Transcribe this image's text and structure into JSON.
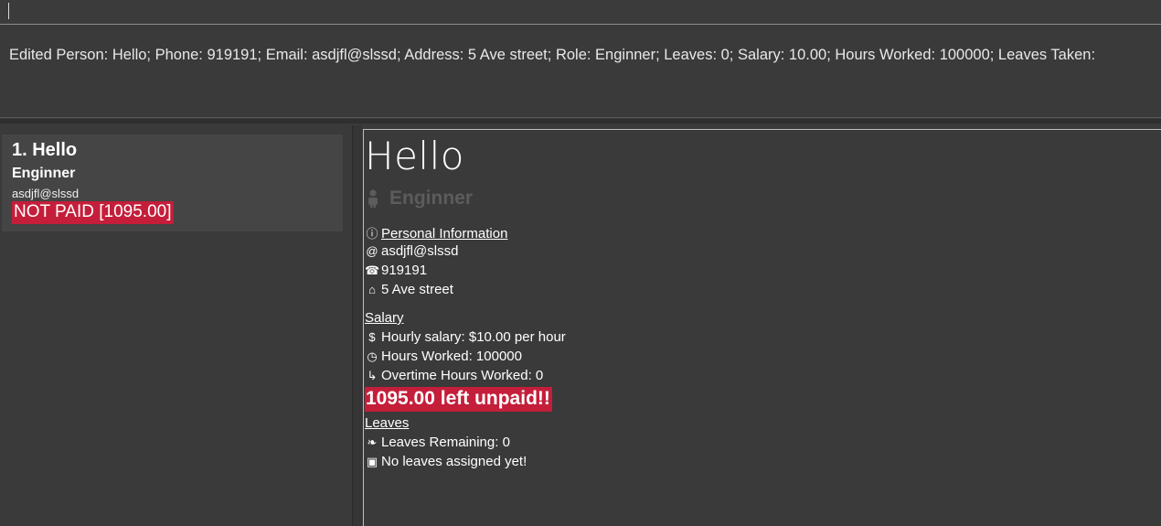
{
  "command": {
    "value": "",
    "placeholder": ""
  },
  "result": {
    "message": "Edited Person: Hello; Phone: 919191; Email: asdjfl@slssd; Address: 5 Ave street; Role: Enginner; Leaves: 0; Salary: 10.00; Hours Worked: 100000; Leaves Taken:"
  },
  "list": {
    "cards": [
      {
        "index_name": "1.  Hello",
        "role": "Enginner",
        "email": "asdjfl@slssd",
        "badge": "NOT PAID [1095.00]"
      }
    ]
  },
  "detail": {
    "name": "Hello",
    "role": "Enginner",
    "personal_title": "Personal Information",
    "email": "asdjfl@slssd",
    "phone": "919191",
    "address": "5 Ave street",
    "salary_title": "Salary",
    "hourly_salary": "Hourly salary: $10.00 per hour",
    "hours_worked": "Hours Worked: 100000",
    "overtime": "Overtime Hours Worked: 0",
    "unpaid": "1095.00 left unpaid!!",
    "leaves_title": "Leaves",
    "leaves_remaining": "Leaves Remaining: 0",
    "leaves_status": "No leaves assigned yet!"
  },
  "icons": {
    "info": "info-icon",
    "email": "at-icon",
    "phone": "phone-icon",
    "address": "home-icon",
    "salary": "dollar-icon",
    "hours": "clock-icon",
    "overtime": "overtime-icon",
    "leaves": "leaf-icon",
    "calendar": "calendar-icon",
    "role": "person-icon"
  },
  "colors": {
    "background": "#3a3a3a",
    "card": "#454545",
    "badge": "#c41e3a",
    "role_muted": "#5c5c5c"
  }
}
